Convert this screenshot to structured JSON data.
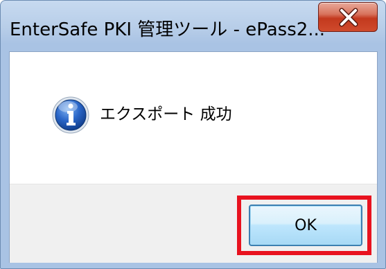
{
  "dialog": {
    "title": "EnterSafe PKI 管理ツール - ePass2...",
    "message": "エクスポート 成功",
    "ok_label": "OK",
    "icon": "information-icon",
    "close_icon": "close-x-icon"
  },
  "colors": {
    "highlight_box": "#e8121f",
    "close_button": "#c3391e",
    "ok_button_border": "#3c7fb1",
    "titlebar": "#b7cde8"
  }
}
